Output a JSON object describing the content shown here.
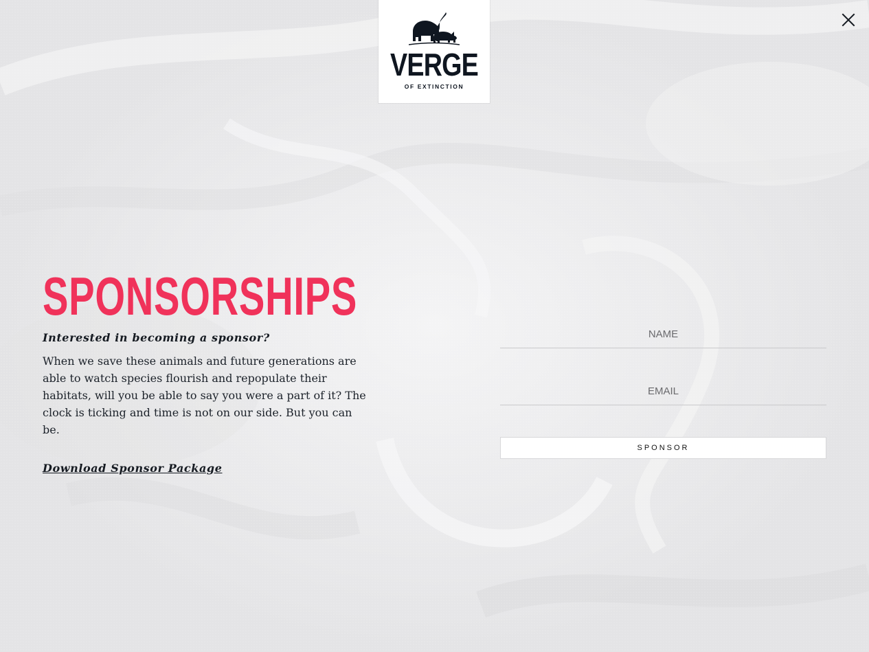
{
  "logo": {
    "wordmark": "VERGE",
    "tagline": "OF EXTINCTION",
    "icon": "elephant-rhino-icon"
  },
  "close": {
    "icon": "close-icon"
  },
  "hero": {
    "title": "SPONSORSHIPS",
    "subtitle": "Interested in becoming a sponsor?",
    "body": "When we save these animals and future generations are able to watch species flourish and repopulate their habitats, will you be able to say you were a part of it? The clock is ticking and time is not on our side. But you can be.",
    "download_link": "Download Sponsor Package"
  },
  "form": {
    "name_placeholder": "NAME",
    "email_placeholder": "EMAIL",
    "submit_label": "SPONSOR"
  },
  "colors": {
    "accent": "#f0325a",
    "text": "#161b22",
    "background": "#e9e9ea"
  }
}
